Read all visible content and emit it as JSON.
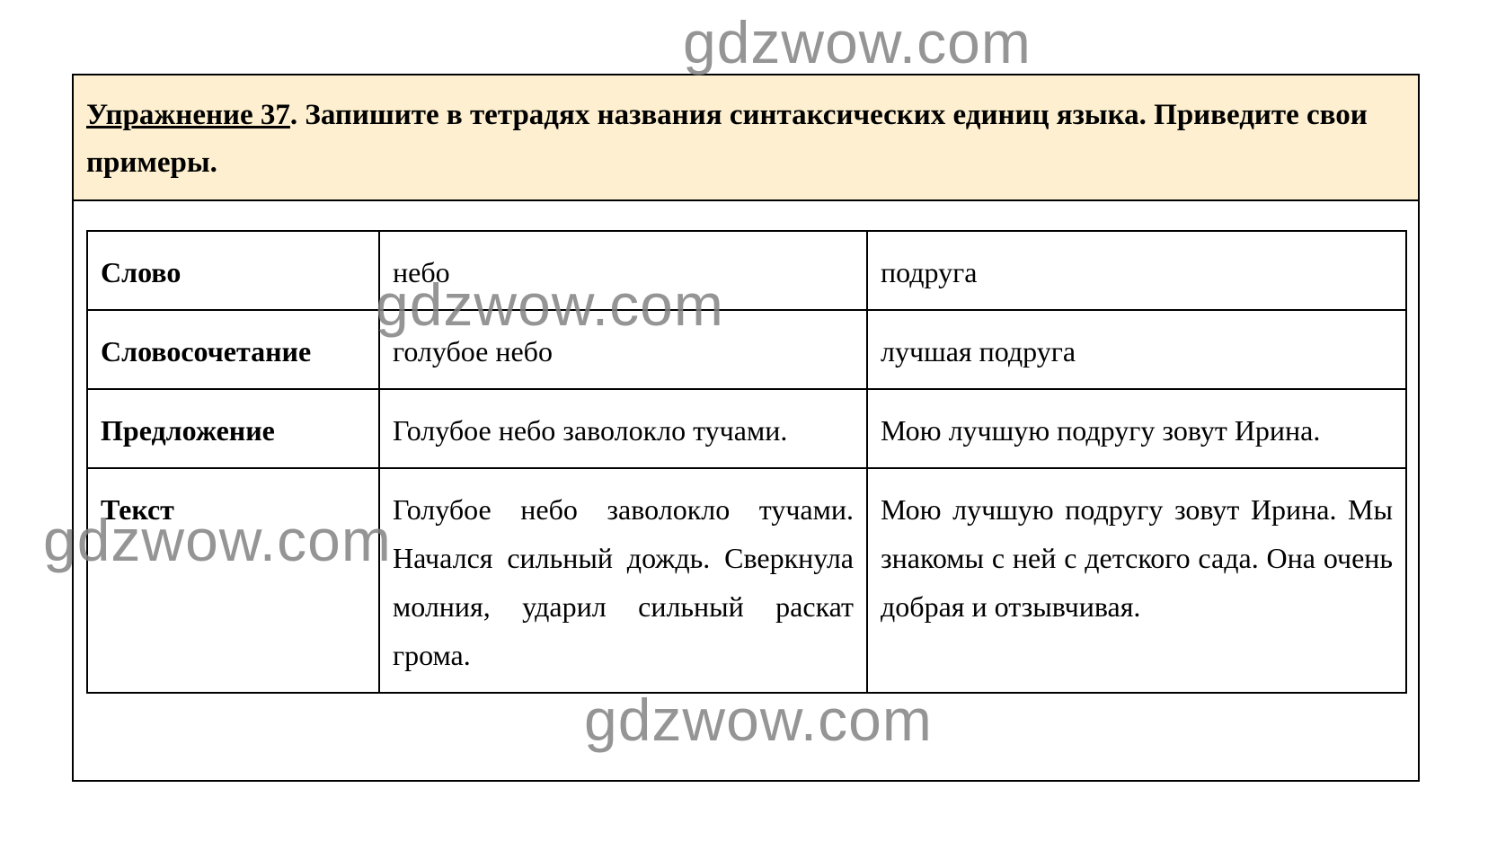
{
  "exercise": {
    "number_label": "Упражнение 37",
    "instruction": ". Запишите в тетрадях названия синтаксических единиц языка. Приведите свои примеры."
  },
  "table": {
    "rows": [
      {
        "label": "Слово",
        "example_1": "небо",
        "example_2": "подруга"
      },
      {
        "label": "Словосочетание",
        "example_1": "голубое небо",
        "example_2": "лучшая подруга"
      },
      {
        "label": "Предложение",
        "example_1": "Голубое небо заволокло тучами.",
        "example_2": "Мою лучшую подругу зовут Ирина."
      },
      {
        "label": "Текст",
        "example_1": "Голубое небо заволокло тучами. Начался сильный дождь. Сверкнула молния, ударил сильный раскат грома.",
        "example_2": "Мою лучшую подругу зовут Ирина. Мы знакомы с ней с детского сада. Она очень добрая и отзывчивая."
      }
    ]
  },
  "watermarks": [
    "gdzwow.com",
    "gdzwow.com",
    "gdzwow.com",
    "gdzwow.com"
  ]
}
